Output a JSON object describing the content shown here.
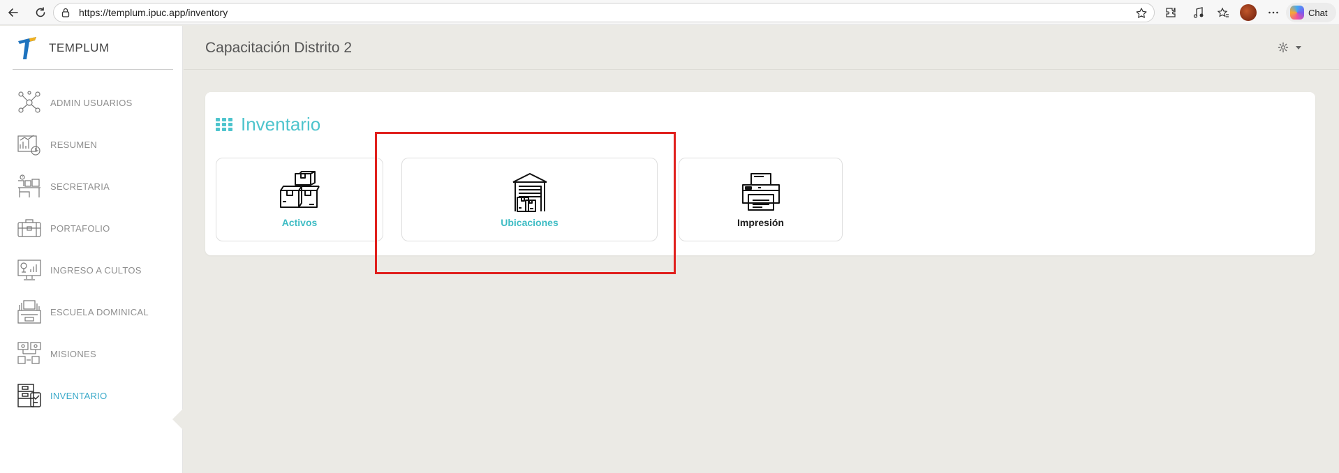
{
  "browser": {
    "url": "https://templum.ipuc.app/inventory",
    "chat_label": "Chat"
  },
  "brand": {
    "name": "TEMPLUM",
    "logo_colors": [
      "#1e73be",
      "#f2b01e"
    ]
  },
  "sidebar": {
    "items": [
      {
        "label": "ADMIN USUARIOS",
        "icon": "users-network-icon",
        "active": false
      },
      {
        "label": "RESUMEN",
        "icon": "report-chart-icon",
        "active": false
      },
      {
        "label": "SECRETARIA",
        "icon": "desk-secretary-icon",
        "active": false
      },
      {
        "label": "PORTAFOLIO",
        "icon": "briefcase-icon",
        "active": false
      },
      {
        "label": "INGRESO A CULTOS",
        "icon": "monitor-stats-icon",
        "active": false
      },
      {
        "label": "ESCUELA DOMINICAL",
        "icon": "school-desk-icon",
        "active": false
      },
      {
        "label": "MISIONES",
        "icon": "mission-board-icon",
        "active": false
      },
      {
        "label": "INVENTARIO",
        "icon": "inventory-icon",
        "active": true
      }
    ]
  },
  "header": {
    "title": "Capacitación Distrito 2"
  },
  "inventory": {
    "title": "Inventario",
    "tiles": [
      {
        "label": "Activos",
        "icon": "boxes-icon"
      },
      {
        "label": "Ubicaciones",
        "icon": "warehouse-icon"
      },
      {
        "label": "Impresión",
        "icon": "printer-icon"
      }
    ]
  },
  "colors": {
    "accent": "#4ec4cd",
    "active_menu": "#3aa9c9",
    "highlight": "#e0201d",
    "background": "#ebeae5"
  }
}
